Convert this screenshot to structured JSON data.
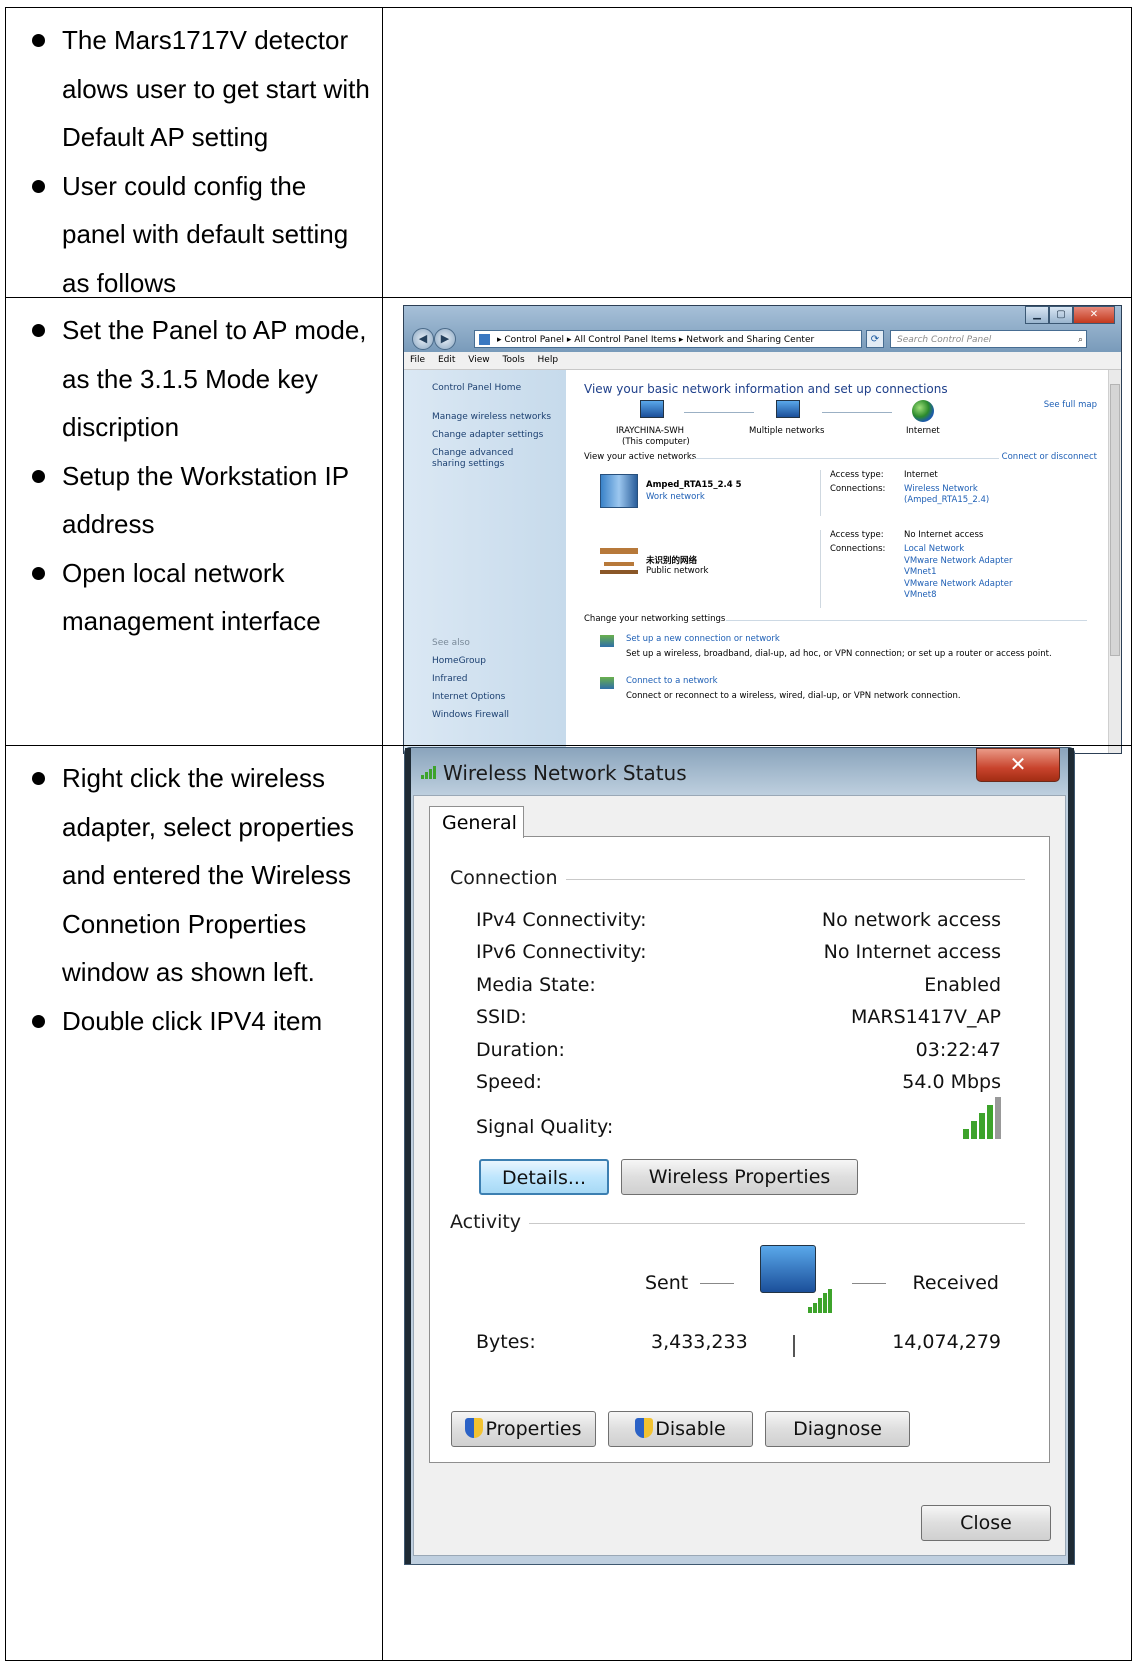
{
  "rows": [
    {
      "bullets": [
        "The Mars1717V detector alows user to get start with Default AP setting",
        "User could config the panel with default setting as follows"
      ]
    },
    {
      "bullets": [
        "Set the Panel to AP mode, as the 3.1.5 Mode key discription",
        "Setup the Workstation IP address",
        "Open local network management interface"
      ]
    },
    {
      "bullets": [
        "Right click the wireless adapter, select properties and entered the Wireless Connetion Properties window as shown left.",
        "Double click IPV4 item"
      ]
    }
  ],
  "control_panel": {
    "address": "▸ Control Panel ▸ All Control Panel Items ▸ Network and Sharing Center",
    "search_placeholder": "Search Control Panel",
    "menu": [
      "File",
      "Edit",
      "View",
      "Tools",
      "Help"
    ],
    "sidebar": {
      "home": "Control Panel Home",
      "links": [
        "Manage wireless networks",
        "Change adapter settings",
        "Change advanced sharing settings"
      ],
      "see_also": "See also",
      "see_also_links": [
        "HomeGroup",
        "Infrared",
        "Internet Options",
        "Windows Firewall"
      ]
    },
    "heading": "View your basic network information and set up connections",
    "see_full_map": "See full map",
    "map": {
      "computer": "IRAYCHINA-SWH",
      "computer_sub": "(This computer)",
      "middle": "Multiple networks",
      "internet": "Internet"
    },
    "active_networks_label": "View your active networks",
    "connect_or_disconnect": "Connect or disconnect",
    "net1": {
      "name": "Amped_RTA15_2.4  5",
      "type": "Work network",
      "access_label": "Access type:",
      "access": "Internet",
      "conn_label": "Connections:",
      "conn": "Wireless Network",
      "conn2": "(Amped_RTA15_2.4)"
    },
    "net2": {
      "name": "未识别的网络",
      "type": "Public network",
      "access_label": "Access type:",
      "access": "No Internet access",
      "conn_label": "Connections:",
      "conns": [
        "Local Network",
        "VMware Network Adapter",
        "VMnet1",
        "VMware Network Adapter",
        "VMnet8"
      ]
    },
    "change_label": "Change your networking settings",
    "tasks": [
      {
        "link": "Set up a new connection or network",
        "desc": "Set up a wireless, broadband, dial-up, ad hoc, or VPN connection; or set up a router or access point."
      },
      {
        "link": "Connect to a network",
        "desc": "Connect or reconnect to a wireless, wired, dial-up, or VPN network connection."
      }
    ]
  },
  "wireless_status": {
    "title": "Wireless Network Status",
    "tab": "General",
    "connection_label": "Connection",
    "rows": [
      {
        "label": "IPv4 Connectivity:",
        "value": "No network access"
      },
      {
        "label": "IPv6 Connectivity:",
        "value": "No Internet access"
      },
      {
        "label": "Media State:",
        "value": "Enabled"
      },
      {
        "label": "SSID:",
        "value": "MARS1417V_AP"
      },
      {
        "label": "Duration:",
        "value": "03:22:47"
      },
      {
        "label": "Speed:",
        "value": "54.0 Mbps"
      }
    ],
    "signal_label": "Signal Quality:",
    "signal_bars": 4,
    "signal_max": 5,
    "details_btn": "Details...",
    "wireless_props_btn": "Wireless Properties",
    "activity_label": "Activity",
    "sent_label": "Sent",
    "received_label": "Received",
    "bytes_label": "Bytes:",
    "bytes_sent": "3,433,233",
    "bytes_received": "14,074,279",
    "properties_btn": "Properties",
    "disable_btn": "Disable",
    "diagnose_btn": "Diagnose",
    "close_btn": "Close"
  }
}
